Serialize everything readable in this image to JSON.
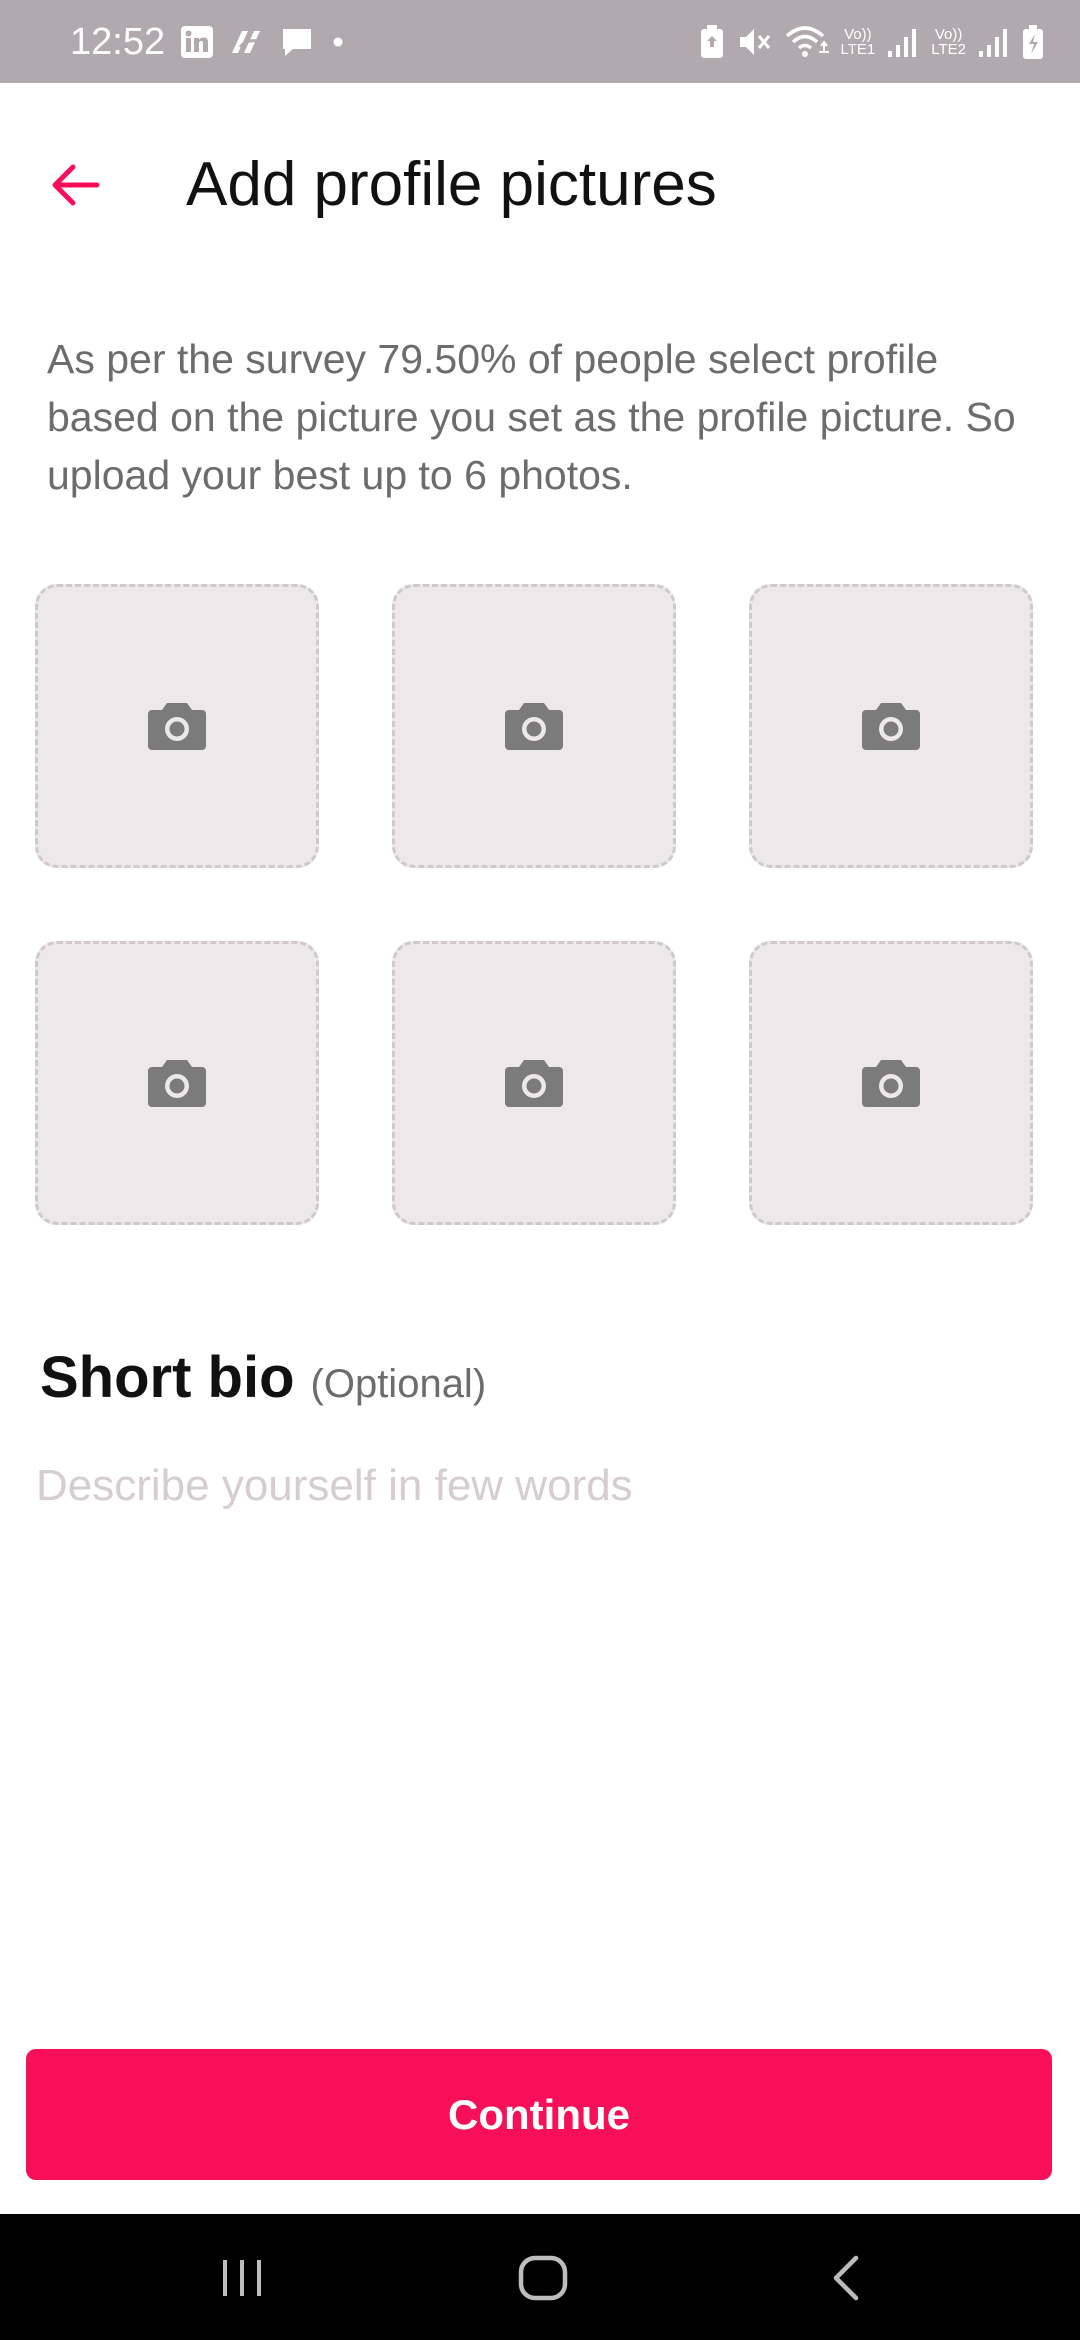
{
  "status_bar": {
    "time": "12:52",
    "left_icons": [
      "linkedin-icon",
      "app-notification-icon",
      "chat-bubble-icon",
      "dot-icon"
    ],
    "right_icons": [
      "battery-saver-icon",
      "mute-icon",
      "wifi-icon",
      "signal-sim1-icon",
      "signal-sim2-icon",
      "battery-icon"
    ],
    "sim1_label_top": "Vo))",
    "sim1_label_bottom": "LTE1",
    "sim2_label_top": "Vo))",
    "sim2_label_bottom": "LTE2"
  },
  "header": {
    "back_icon": "arrow-left-icon",
    "title": "Add profile pictures"
  },
  "description": "As per the survey 79.50% of people select profile based on the picture you set as the profile picture. So upload your best up to 6 photos.",
  "photo_slots": [
    {
      "icon": "camera-icon"
    },
    {
      "icon": "camera-icon"
    },
    {
      "icon": "camera-icon"
    },
    {
      "icon": "camera-icon"
    },
    {
      "icon": "camera-icon"
    },
    {
      "icon": "camera-icon"
    }
  ],
  "bio": {
    "title": "Short bio",
    "optional_label": "(Optional)",
    "placeholder": "Describe yourself in few words",
    "value": ""
  },
  "continue_label": "Continue",
  "nav_bar": {
    "icons": [
      "recents-icon",
      "home-icon",
      "back-icon"
    ]
  },
  "colors": {
    "accent": "#f71059",
    "status_bar": "#b2a9ae",
    "slot_background": "#ede8e9",
    "slot_border": "#cfc9cb",
    "description_text": "#6e6b6d",
    "placeholder_text": "#d6cdd0"
  }
}
